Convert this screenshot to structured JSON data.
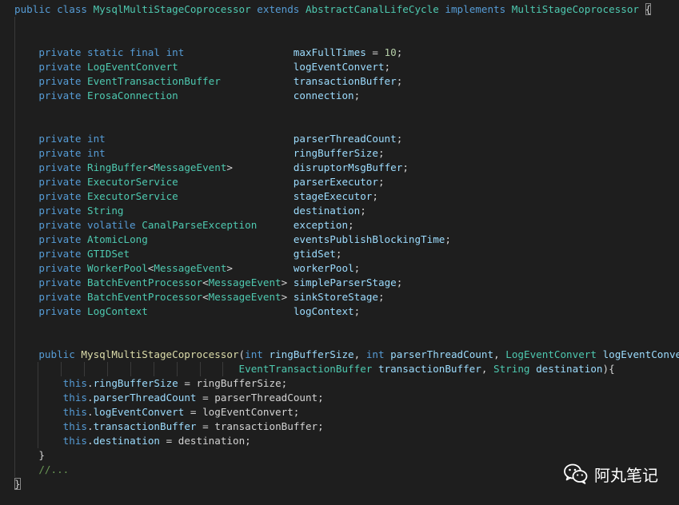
{
  "code": {
    "lines": [
      {
        "segments": [
          {
            "t": "public class ",
            "c": "kw"
          },
          {
            "t": "MysqlMultiStageCoprocessor",
            "c": "ty"
          },
          {
            "t": " extends ",
            "c": "kw"
          },
          {
            "t": "AbstractCanalLifeCycle",
            "c": "ty"
          },
          {
            "t": " implements ",
            "c": "kw"
          },
          {
            "t": "MultiStageCoprocessor",
            "c": "ty"
          },
          {
            "t": " "
          },
          {
            "t": "{",
            "c": "pu",
            "br": true
          }
        ]
      },
      {
        "segments": []
      },
      {
        "segments": []
      },
      {
        "segments": [
          {
            "t": "    private static final ",
            "c": "kw"
          },
          {
            "t": "int",
            "c": "kw"
          },
          {
            "t": "                  "
          },
          {
            "t": "maxFullTimes",
            "c": "vr"
          },
          {
            "t": " = ",
            "c": "pu"
          },
          {
            "t": "10",
            "c": "nm"
          },
          {
            "t": ";",
            "c": "pu"
          }
        ]
      },
      {
        "segments": [
          {
            "t": "    private ",
            "c": "kw"
          },
          {
            "t": "LogEventConvert",
            "c": "ty"
          },
          {
            "t": "                   "
          },
          {
            "t": "logEventConvert",
            "c": "vr"
          },
          {
            "t": ";",
            "c": "pu"
          }
        ]
      },
      {
        "segments": [
          {
            "t": "    private ",
            "c": "kw"
          },
          {
            "t": "EventTransactionBuffer",
            "c": "ty"
          },
          {
            "t": "            "
          },
          {
            "t": "transactionBuffer",
            "c": "vr"
          },
          {
            "t": ";",
            "c": "pu"
          }
        ]
      },
      {
        "segments": [
          {
            "t": "    private ",
            "c": "kw"
          },
          {
            "t": "ErosaConnection",
            "c": "ty"
          },
          {
            "t": "                   "
          },
          {
            "t": "connection",
            "c": "vr"
          },
          {
            "t": ";",
            "c": "pu"
          }
        ]
      },
      {
        "segments": []
      },
      {
        "segments": []
      },
      {
        "segments": [
          {
            "t": "    private ",
            "c": "kw"
          },
          {
            "t": "int",
            "c": "kw"
          },
          {
            "t": "                               "
          },
          {
            "t": "parserThreadCount",
            "c": "vr"
          },
          {
            "t": ";",
            "c": "pu"
          }
        ]
      },
      {
        "segments": [
          {
            "t": "    private ",
            "c": "kw"
          },
          {
            "t": "int",
            "c": "kw"
          },
          {
            "t": "                               "
          },
          {
            "t": "ringBufferSize",
            "c": "vr"
          },
          {
            "t": ";",
            "c": "pu"
          }
        ]
      },
      {
        "segments": [
          {
            "t": "    private ",
            "c": "kw"
          },
          {
            "t": "RingBuffer",
            "c": "ty"
          },
          {
            "t": "<",
            "c": "pu"
          },
          {
            "t": "MessageEvent",
            "c": "ty"
          },
          {
            "t": ">",
            "c": "pu"
          },
          {
            "t": "          "
          },
          {
            "t": "disruptorMsgBuffer",
            "c": "vr"
          },
          {
            "t": ";",
            "c": "pu"
          }
        ]
      },
      {
        "segments": [
          {
            "t": "    private ",
            "c": "kw"
          },
          {
            "t": "ExecutorService",
            "c": "ty"
          },
          {
            "t": "                   "
          },
          {
            "t": "parserExecutor",
            "c": "vr"
          },
          {
            "t": ";",
            "c": "pu"
          }
        ]
      },
      {
        "segments": [
          {
            "t": "    private ",
            "c": "kw"
          },
          {
            "t": "ExecutorService",
            "c": "ty"
          },
          {
            "t": "                   "
          },
          {
            "t": "stageExecutor",
            "c": "vr"
          },
          {
            "t": ";",
            "c": "pu"
          }
        ]
      },
      {
        "segments": [
          {
            "t": "    private ",
            "c": "kw"
          },
          {
            "t": "String",
            "c": "ty"
          },
          {
            "t": "                            "
          },
          {
            "t": "destination",
            "c": "vr"
          },
          {
            "t": ";",
            "c": "pu"
          }
        ]
      },
      {
        "segments": [
          {
            "t": "    private volatile ",
            "c": "kw"
          },
          {
            "t": "CanalParseException",
            "c": "ty"
          },
          {
            "t": "      "
          },
          {
            "t": "exception",
            "c": "vr"
          },
          {
            "t": ";",
            "c": "pu"
          }
        ]
      },
      {
        "segments": [
          {
            "t": "    private ",
            "c": "kw"
          },
          {
            "t": "AtomicLong",
            "c": "ty"
          },
          {
            "t": "                        "
          },
          {
            "t": "eventsPublishBlockingTime",
            "c": "vr"
          },
          {
            "t": ";",
            "c": "pu"
          }
        ]
      },
      {
        "segments": [
          {
            "t": "    private ",
            "c": "kw"
          },
          {
            "t": "GTIDSet",
            "c": "ty"
          },
          {
            "t": "                           "
          },
          {
            "t": "gtidSet",
            "c": "vr"
          },
          {
            "t": ";",
            "c": "pu"
          }
        ]
      },
      {
        "segments": [
          {
            "t": "    private ",
            "c": "kw"
          },
          {
            "t": "WorkerPool",
            "c": "ty"
          },
          {
            "t": "<",
            "c": "pu"
          },
          {
            "t": "MessageEvent",
            "c": "ty"
          },
          {
            "t": ">",
            "c": "pu"
          },
          {
            "t": "          "
          },
          {
            "t": "workerPool",
            "c": "vr"
          },
          {
            "t": ";",
            "c": "pu"
          }
        ]
      },
      {
        "segments": [
          {
            "t": "    private ",
            "c": "kw"
          },
          {
            "t": "BatchEventProcessor",
            "c": "ty"
          },
          {
            "t": "<",
            "c": "pu"
          },
          {
            "t": "MessageEvent",
            "c": "ty"
          },
          {
            "t": ">",
            "c": "pu"
          },
          {
            "t": " "
          },
          {
            "t": "simpleParserStage",
            "c": "vr"
          },
          {
            "t": ";",
            "c": "pu"
          }
        ]
      },
      {
        "segments": [
          {
            "t": "    private ",
            "c": "kw"
          },
          {
            "t": "BatchEventProcessor",
            "c": "ty"
          },
          {
            "t": "<",
            "c": "pu"
          },
          {
            "t": "MessageEvent",
            "c": "ty"
          },
          {
            "t": ">",
            "c": "pu"
          },
          {
            "t": " "
          },
          {
            "t": "sinkStoreStage",
            "c": "vr"
          },
          {
            "t": ";",
            "c": "pu"
          }
        ]
      },
      {
        "segments": [
          {
            "t": "    private ",
            "c": "kw"
          },
          {
            "t": "LogContext",
            "c": "ty"
          },
          {
            "t": "                        "
          },
          {
            "t": "logContext",
            "c": "vr"
          },
          {
            "t": ";",
            "c": "pu"
          }
        ]
      },
      {
        "segments": []
      },
      {
        "segments": []
      },
      {
        "segments": [
          {
            "t": "    public ",
            "c": "kw"
          },
          {
            "t": "MysqlMultiStageCoprocessor",
            "c": "fn"
          },
          {
            "t": "(",
            "c": "pu"
          },
          {
            "t": "int ",
            "c": "kw"
          },
          {
            "t": "ringBufferSize",
            "c": "vr"
          },
          {
            "t": ", ",
            "c": "pu"
          },
          {
            "t": "int ",
            "c": "kw"
          },
          {
            "t": "parserThreadCount",
            "c": "vr"
          },
          {
            "t": ", ",
            "c": "pu"
          },
          {
            "t": "LogEventConvert ",
            "c": "ty"
          },
          {
            "t": "logEventConvert",
            "c": "vr"
          },
          {
            "t": ",",
            "c": "pu"
          }
        ]
      },
      {
        "segments": [
          {
            "t": "                                     "
          },
          {
            "t": "EventTransactionBuffer ",
            "c": "ty"
          },
          {
            "t": "transactionBuffer",
            "c": "vr"
          },
          {
            "t": ", ",
            "c": "pu"
          },
          {
            "t": "String ",
            "c": "ty"
          },
          {
            "t": "destination",
            "c": "vr"
          },
          {
            "t": "){",
            "c": "pu"
          }
        ]
      },
      {
        "segments": [
          {
            "t": "        this",
            "c": "kw"
          },
          {
            "t": ".",
            "c": "pu"
          },
          {
            "t": "ringBufferSize",
            "c": "vr"
          },
          {
            "t": " = ringBufferSize;",
            "c": "pu"
          }
        ]
      },
      {
        "segments": [
          {
            "t": "        this",
            "c": "kw"
          },
          {
            "t": ".",
            "c": "pu"
          },
          {
            "t": "parserThreadCount",
            "c": "vr"
          },
          {
            "t": " = parserThreadCount;",
            "c": "pu"
          }
        ]
      },
      {
        "segments": [
          {
            "t": "        this",
            "c": "kw"
          },
          {
            "t": ".",
            "c": "pu"
          },
          {
            "t": "logEventConvert",
            "c": "vr"
          },
          {
            "t": " = logEventConvert;",
            "c": "pu"
          }
        ]
      },
      {
        "segments": [
          {
            "t": "        this",
            "c": "kw"
          },
          {
            "t": ".",
            "c": "pu"
          },
          {
            "t": "transactionBuffer",
            "c": "vr"
          },
          {
            "t": " = transactionBuffer;",
            "c": "pu"
          }
        ]
      },
      {
        "segments": [
          {
            "t": "        this",
            "c": "kw"
          },
          {
            "t": ".",
            "c": "pu"
          },
          {
            "t": "destination",
            "c": "vr"
          },
          {
            "t": " = destination;",
            "c": "pu"
          }
        ]
      },
      {
        "segments": [
          {
            "t": "    }",
            "c": "pu"
          }
        ]
      },
      {
        "segments": [
          {
            "t": "    //...",
            "c": "cm"
          }
        ]
      },
      {
        "segments": [
          {
            "t": "}",
            "c": "pu",
            "br": true
          }
        ]
      }
    ]
  },
  "watermark": {
    "label": "阿丸笔记",
    "icon": "wechat-icon"
  },
  "colors": {
    "background": "#1e1e1e",
    "keyword": "#569cd6",
    "type": "#4ec9b0",
    "variable": "#9cdcfe",
    "function": "#dcdcaa",
    "number": "#b5cea8",
    "comment": "#6a9955"
  }
}
